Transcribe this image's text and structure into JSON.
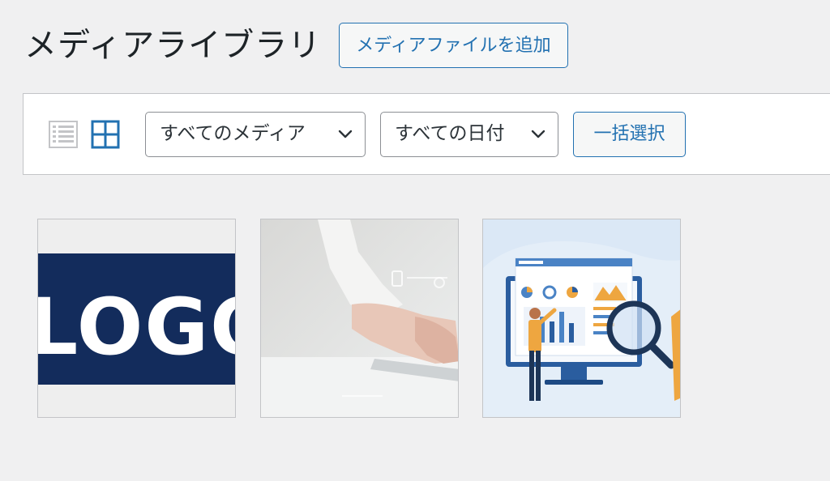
{
  "header": {
    "title": "メディアライブラリ",
    "add_button": "メディアファイルを追加"
  },
  "toolbar": {
    "view_modes": [
      {
        "name": "list-view",
        "icon": "list-icon",
        "active": false
      },
      {
        "name": "grid-view",
        "icon": "grid-icon",
        "active": true
      }
    ],
    "type_filter": "すべてのメディア",
    "date_filter": "すべての日付",
    "bulk_select": "一括選択"
  },
  "media": [
    {
      "name": "logo-image",
      "logo_text": "LOGO"
    },
    {
      "name": "typing-photo"
    },
    {
      "name": "analytics-illustration"
    }
  ],
  "colors": {
    "accent": "#2271b1",
    "logo_bg": "#132c5c",
    "illustration_bg": "#dbe8f6",
    "figure_orange": "#eea640"
  }
}
